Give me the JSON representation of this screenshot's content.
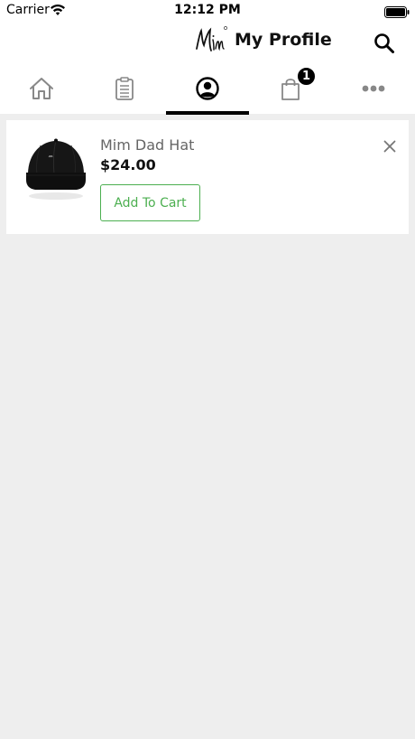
{
  "status_bar": {
    "carrier": "Carrier",
    "time": "12:12 PM",
    "wifi_icon": "wifi-icon",
    "battery_icon": "battery-icon"
  },
  "header": {
    "title": "My Profile",
    "logo_icon": "brand-logo",
    "search_icon": "search-icon"
  },
  "tabs": [
    {
      "name": "home",
      "icon": "home-icon",
      "active": false
    },
    {
      "name": "orders",
      "icon": "clipboard-icon",
      "active": false
    },
    {
      "name": "profile",
      "icon": "user-circle-icon",
      "active": true
    },
    {
      "name": "cart",
      "icon": "shopping-bag-icon",
      "active": false,
      "badge": "1"
    },
    {
      "name": "more",
      "icon": "more-dots-icon",
      "active": false
    }
  ],
  "wishlist": {
    "items": [
      {
        "name": "Mim Dad Hat",
        "price": "$24.00",
        "add_label": "Add To Cart",
        "image_icon": "cap-image",
        "remove_icon": "close-icon"
      }
    ]
  },
  "colors": {
    "accent": "#4caf50",
    "background": "#eeeeee",
    "tab_indicator": "#000000"
  }
}
